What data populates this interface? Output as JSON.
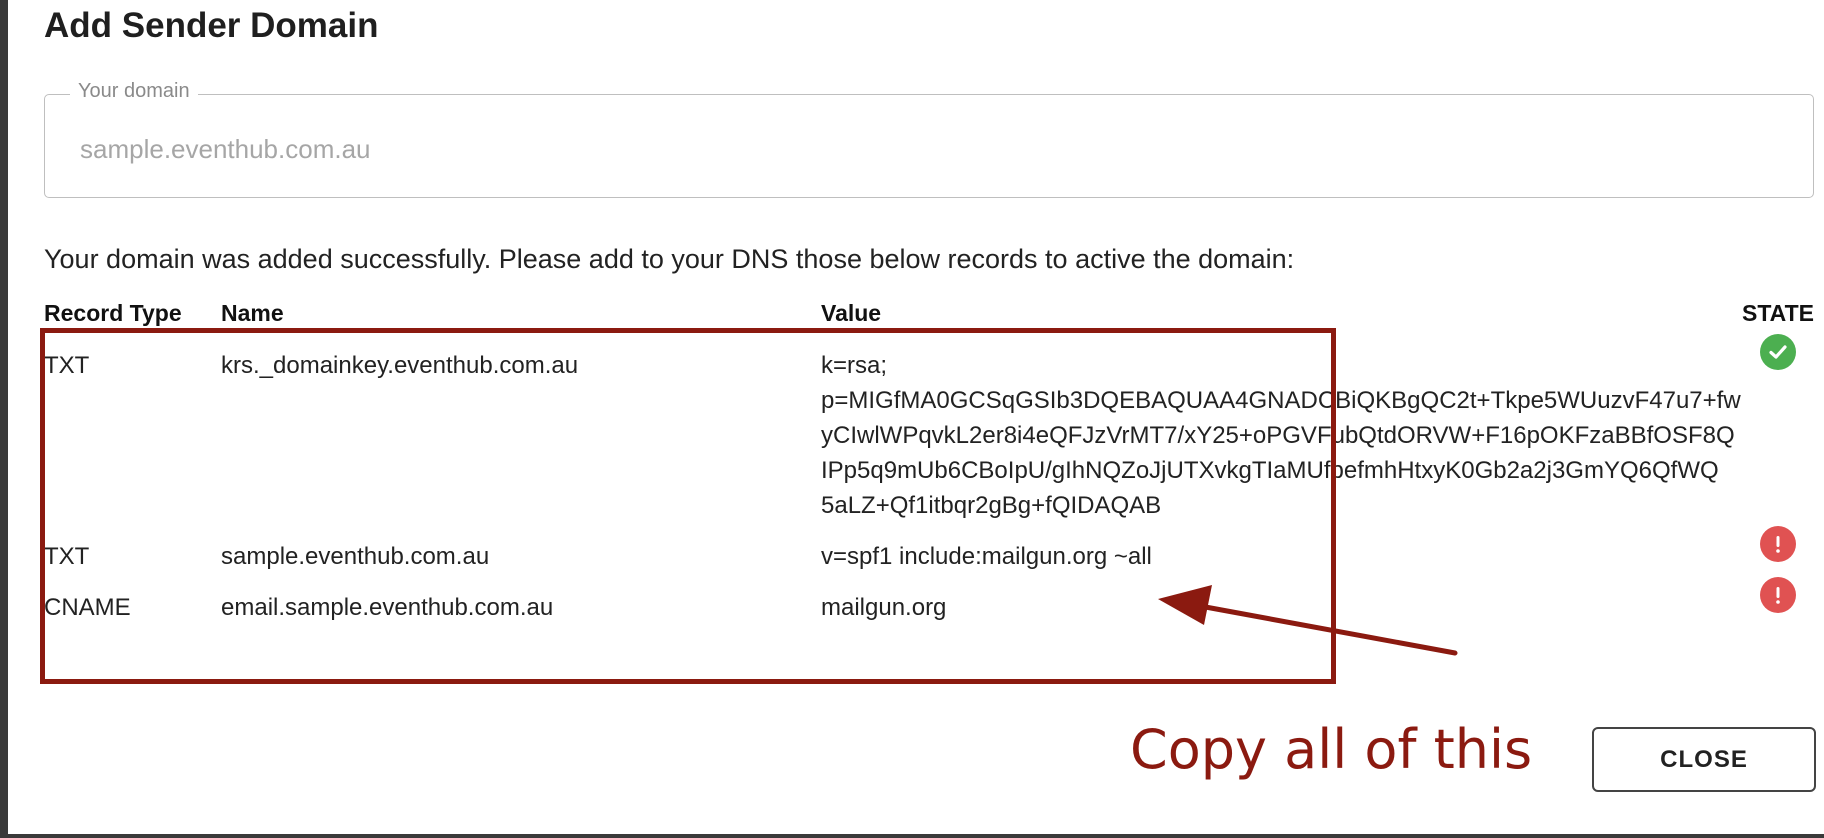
{
  "dialog": {
    "title": "Add Sender Domain",
    "domain_field": {
      "label": "Your domain",
      "placeholder": "sample.eventhub.com.au"
    },
    "success_message": "Your domain was added successfully. Please add to your DNS those below records to active the domain:",
    "table": {
      "headers": {
        "record_type": "Record Type",
        "name": "Name",
        "value": "Value",
        "state": "STATE"
      },
      "rows": [
        {
          "type": "TXT",
          "name": "krs._domainkey.eventhub.com.au",
          "value_lines": [
            "k=rsa;",
            "p=MIGfMA0GCSqGSIb3DQEBAQUAA4GNADCBiQKBgQC2t+Tkpe5WUuzvF47u7+fw",
            "yCIwlWPqvkL2er8i4eQFJzVrMT7/xY25+oPGVFubQtdORVW+F16pOKFzaBBfOSF8Q",
            "IPp5q9mUb6CBoIpU/gIhNQZoJjUTXvkgTIaMUfbefmhHtxyK0Gb2a2j3GmYQ6QfWQ",
            "5aLZ+Qf1itbqr2gBg+fQIDAQAB"
          ],
          "state": "verified",
          "state_icon": "check-circle-icon",
          "state_color": "#4caf50"
        },
        {
          "type": "TXT",
          "name": "sample.eventhub.com.au",
          "value_lines": [
            "v=spf1 include:mailgun.org ~all"
          ],
          "state": "error",
          "state_icon": "exclamation-circle-icon",
          "state_color": "#e05252"
        },
        {
          "type": "CNAME",
          "name": "email.sample.eventhub.com.au",
          "value_lines": [
            "mailgun.org"
          ],
          "state": "error",
          "state_icon": "exclamation-circle-icon",
          "state_color": "#e05252"
        }
      ]
    },
    "close_label": "CLOSE"
  },
  "annotation": {
    "text": "Copy all of this",
    "color": "#8b1a10"
  }
}
